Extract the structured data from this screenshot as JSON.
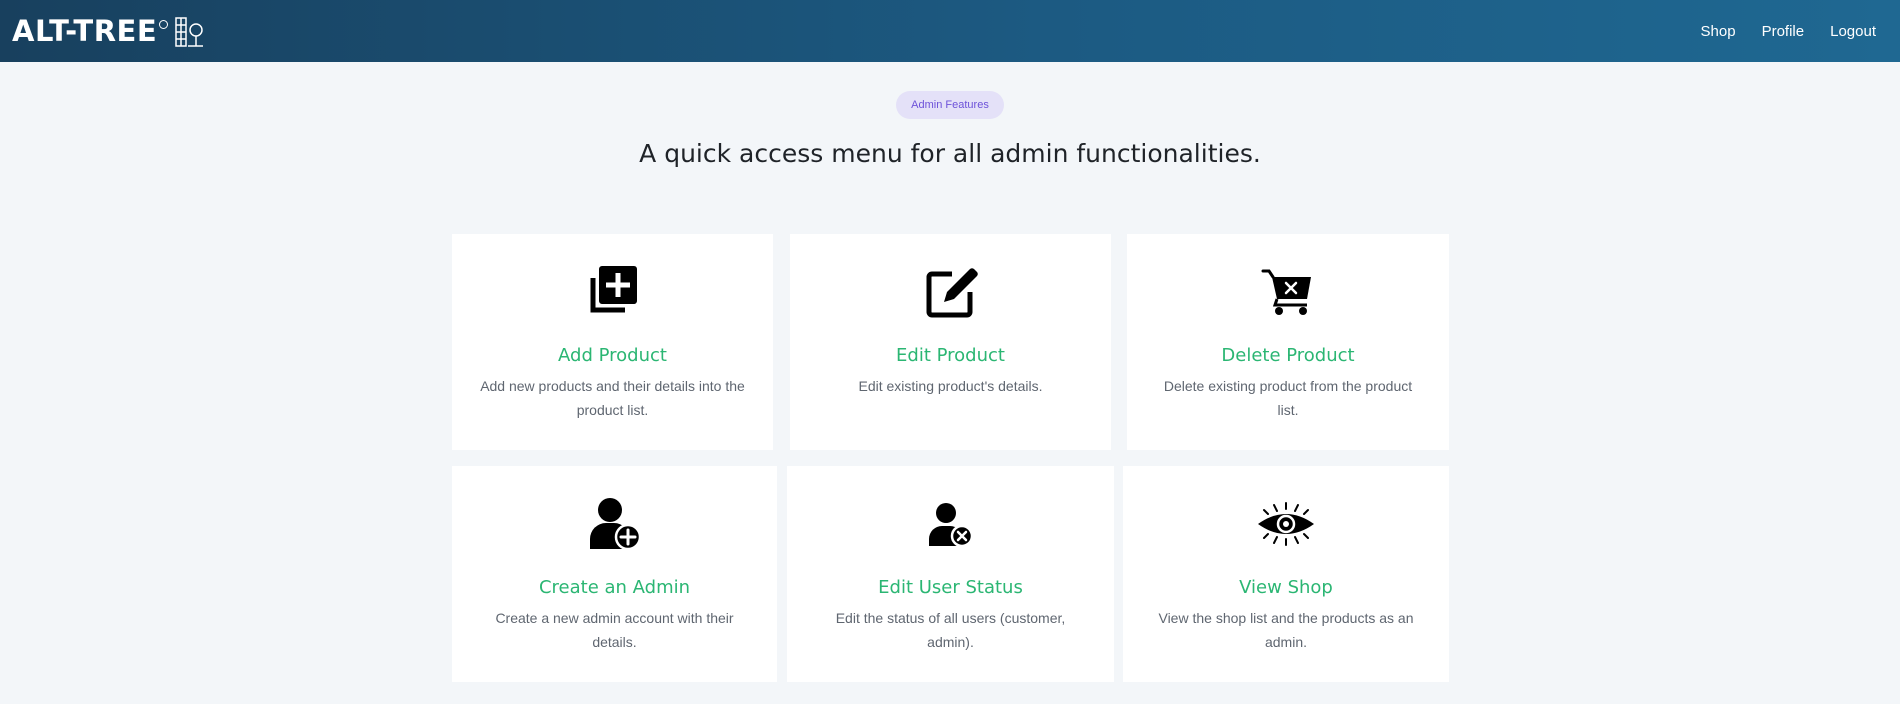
{
  "header": {
    "brand": "ALT-TREE",
    "nav": [
      {
        "label": "Shop"
      },
      {
        "label": "Profile"
      },
      {
        "label": "Logout"
      }
    ]
  },
  "hero": {
    "badge": "Admin Features",
    "subtitle": "A quick access menu for all admin functionalities."
  },
  "cards": [
    {
      "icon": "add-box-icon",
      "title": "Add Product",
      "description": "Add new products and their details into the product list."
    },
    {
      "icon": "edit-square-icon",
      "title": "Edit Product",
      "description": "Edit existing product's details."
    },
    {
      "icon": "cart-remove-icon",
      "title": "Delete Product",
      "description": "Delete existing product from the product list."
    },
    {
      "icon": "user-plus-icon",
      "title": "Create an Admin",
      "description": "Create a new admin account with their details."
    },
    {
      "icon": "user-remove-icon",
      "title": "Edit User Status",
      "description": "Edit the status of all users (customer, admin)."
    },
    {
      "icon": "eye-icon",
      "title": "View Shop",
      "description": "View the shop list and the products as an admin."
    }
  ],
  "colors": {
    "header_start": "#18405e",
    "header_end": "#1f6892",
    "accent_green": "#2bb673",
    "badge_bg": "#e4e1f8",
    "badge_text": "#6d52d9",
    "page_bg": "#f3f6f9"
  }
}
